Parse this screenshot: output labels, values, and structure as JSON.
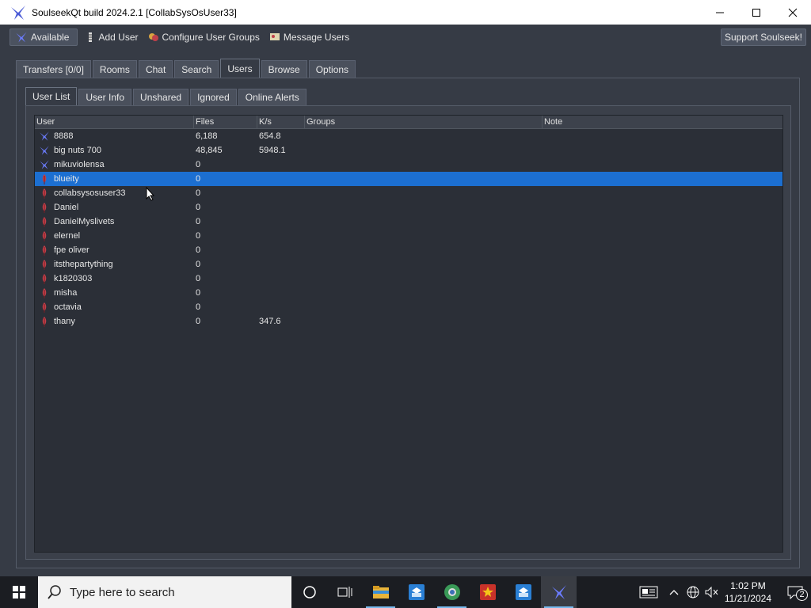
{
  "window": {
    "title": "SoulseekQt build 2024.2.1 [CollabSysOsUser33]"
  },
  "toolbar": {
    "status": "Available",
    "add_user": "Add User",
    "configure_groups": "Configure User Groups",
    "message_users": "Message Users",
    "support": "Support Soulseek!"
  },
  "main_tabs": [
    "Transfers [0/0]",
    "Rooms",
    "Chat",
    "Search",
    "Users",
    "Browse",
    "Options"
  ],
  "sub_tabs": [
    "User List",
    "User Info",
    "Unshared",
    "Ignored",
    "Online Alerts"
  ],
  "table": {
    "headers": {
      "user": "User",
      "files": "Files",
      "kps": "K/s",
      "groups": "Groups",
      "note": "Note"
    },
    "rows": [
      {
        "user": "8888",
        "files": "6,188",
        "kps": "654.8",
        "status": "online"
      },
      {
        "user": "big nuts 700",
        "files": "48,845",
        "kps": "5948.1",
        "status": "online"
      },
      {
        "user": "mikuviolensa",
        "files": "0",
        "kps": "",
        "status": "online"
      },
      {
        "user": "blueity",
        "files": "0",
        "kps": "",
        "status": "offline"
      },
      {
        "user": "collabsysosuser33",
        "files": "0",
        "kps": "",
        "status": "offline"
      },
      {
        "user": "Daniel",
        "files": "0",
        "kps": "",
        "status": "offline"
      },
      {
        "user": "DanielMyslivets",
        "files": "0",
        "kps": "",
        "status": "offline"
      },
      {
        "user": "elernel",
        "files": "0",
        "kps": "",
        "status": "offline"
      },
      {
        "user": "fpe oliver",
        "files": "0",
        "kps": "",
        "status": "offline"
      },
      {
        "user": "itsthepartything",
        "files": "0",
        "kps": "",
        "status": "offline"
      },
      {
        "user": "k1820303",
        "files": "0",
        "kps": "",
        "status": "offline"
      },
      {
        "user": "misha",
        "files": "0",
        "kps": "",
        "status": "offline"
      },
      {
        "user": "octavia",
        "files": "0",
        "kps": "",
        "status": "offline"
      },
      {
        "user": "thany",
        "files": "0",
        "kps": "347.6",
        "status": "offline"
      }
    ],
    "selected_row": "blueity"
  },
  "taskbar": {
    "search_placeholder": "Type here to search",
    "time": "1:02 PM",
    "date": "11/21/2024",
    "notifications": "2"
  },
  "colors": {
    "accent": "#1c6fd1",
    "online": "#6b7cff",
    "offline": "#c0404a"
  }
}
